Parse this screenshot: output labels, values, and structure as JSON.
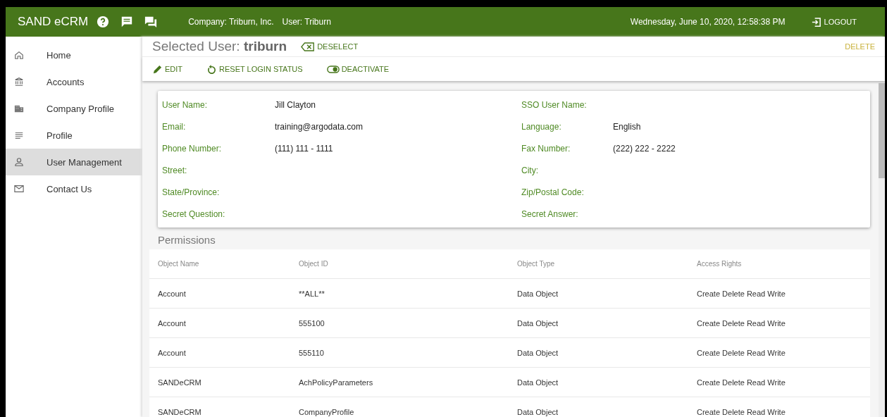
{
  "topbar": {
    "app_name": "SAND eCRM",
    "company": "Company: Triburn, Inc.",
    "user": "User: Triburn",
    "datetime": "Wednesday, June 10, 2020, 12:58:38 PM",
    "logout": "LOGOUT"
  },
  "sidebar": {
    "items": [
      {
        "label": "Home",
        "selected": false
      },
      {
        "label": "Accounts",
        "selected": false
      },
      {
        "label": "Company Profile",
        "selected": false
      },
      {
        "label": "Profile",
        "selected": false
      },
      {
        "label": "User Management",
        "selected": true
      },
      {
        "label": "Contact Us",
        "selected": false
      }
    ]
  },
  "header": {
    "title": "Selected User: **triburn**",
    "deselect": "DESELECT",
    "delete": "DELETE"
  },
  "toolbar": [
    "EDIT",
    "RESET LOGIN STATUS",
    "DEACTIVATE"
  ],
  "details": [
    {
      "label": "User Name:",
      "value": "Jill Clayton",
      "label_2": "SSO User Name:"
    },
    {
      "label": "Email:",
      "value": "training@argodata.com",
      "label_2": "Language:",
      "value_2": "English"
    },
    {
      "label": "Phone Number:",
      "value": "(111) 111 - 1111",
      "label_2": "Fax Number:",
      "value_2": "(222) 222 - 2222"
    },
    {
      "label": "Street:",
      "label_2": "City:"
    },
    {
      "label": "State/Province:",
      "label_2": "Zip/Postal Code:"
    },
    {
      "label": "Secret Question:",
      "label_2": "Secret Answer:"
    }
  ],
  "permissions": {
    "title": "Permissions",
    "columns": [
      "Object Name",
      "Object ID",
      "Object Type",
      "Access Rights"
    ],
    "rows": [
      [
        "Account",
        "**ALL**",
        "Data Object",
        "Create Delete Read Write"
      ],
      [
        "Account",
        "555100",
        "Data Object",
        "Create Delete Read Write"
      ],
      [
        "Account",
        "555110",
        "Data Object",
        "Create Delete Read Write"
      ],
      [
        "SANDeCRM",
        "AchPolicyParameters",
        "Data Object",
        "Create Delete Read Write"
      ],
      [
        "SANDeCRM",
        "CompanyProfile",
        "Data Object",
        "Create Delete Read Write"
      ]
    ]
  }
}
